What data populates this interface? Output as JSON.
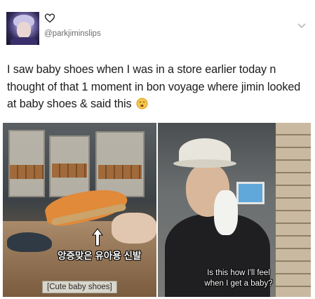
{
  "tweet": {
    "handle": "@parkjiminslips",
    "text": "I saw baby shoes when I was in a store earlier today n thought of that 1 moment in bon voyage where jimin looked at baby shoes & said this",
    "emoji": "crying-face-emoji"
  },
  "icons": {
    "heart": "heart-outline-icon",
    "menu": "chevron-down-icon"
  },
  "media": {
    "left": {
      "korean_caption": "앙증맞은 유아용 신발",
      "label": "[Cute baby shoes]"
    },
    "right": {
      "caption_line1": "Is this how I'll feel",
      "caption_line2": "when I get a baby?"
    }
  },
  "colors": {
    "handle": "#6b6b6b",
    "text": "#1b1b1b",
    "background": "#ffffff"
  }
}
